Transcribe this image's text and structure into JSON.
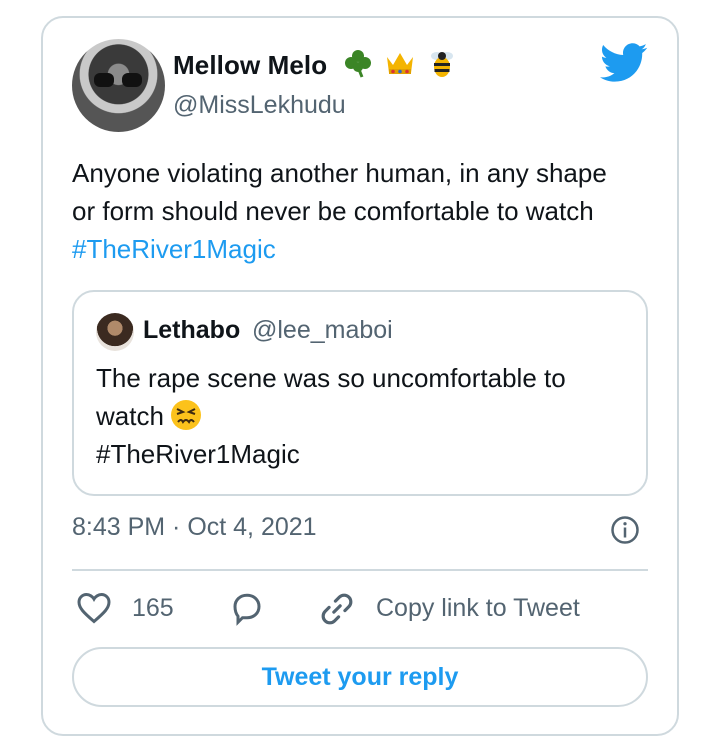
{
  "tweet": {
    "author_name": "Mellow Melo",
    "author_emojis": [
      "shamrock-emoji",
      "crown-emoji",
      "bee-emoji"
    ],
    "author_handle": "@MissLekhudu",
    "text_line1": "Anyone violating another human, in any shape",
    "text_line2": "or form should never be comfortable to watch",
    "hashtag": "#TheRiver1Magic",
    "timestamp": "8:43 PM · Oct 4, 2021",
    "likes": "165",
    "copy_link_label": "Copy link to Tweet",
    "reply_button_label": "Tweet your reply"
  },
  "quoted": {
    "author_name": "Lethabo",
    "author_handle": "@lee_maboi",
    "text_line1": "The rape scene was so uncomfortable to",
    "text_line2": "watch",
    "emoji": "tired-face-emoji",
    "hashtag": "#TheRiver1Magic"
  },
  "colors": {
    "accent": "#1d9bf0",
    "secondary_text": "#536471",
    "border": "#cfd9de"
  },
  "icons": [
    "twitter-bird-icon",
    "info-icon",
    "heart-icon",
    "reply-icon",
    "link-icon"
  ]
}
